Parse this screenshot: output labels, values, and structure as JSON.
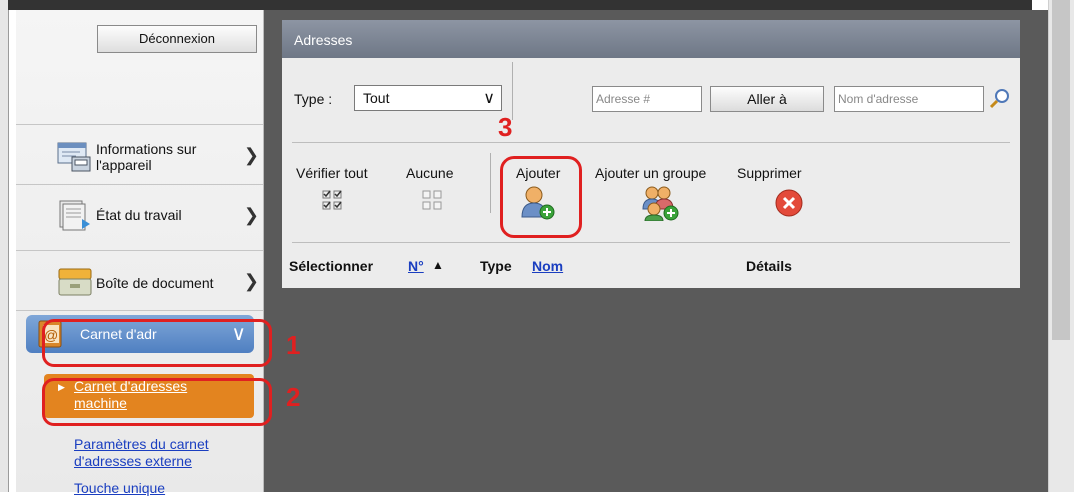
{
  "sidebar": {
    "logout": "Déconnexion",
    "items": [
      {
        "label_line1": "Informations sur",
        "label_line2": "l'appareil",
        "icon": "device-info-icon"
      },
      {
        "label": "État du travail",
        "icon": "job-status-icon"
      },
      {
        "label": "Boîte de document",
        "icon": "document-box-icon"
      }
    ],
    "address_book": {
      "label": "Carnet d'adr",
      "icon": "address-book-icon"
    },
    "submenu": [
      {
        "line1": "Carnet d'adresses",
        "line2": "machine"
      },
      {
        "line1": "Paramètres du carnet",
        "line2": "d'adresses externe"
      },
      {
        "line1": "Touche unique"
      }
    ]
  },
  "panel": {
    "title": "Adresses",
    "type_label": "Type :",
    "type_value": "Tout",
    "address_number_placeholder": "Adresse #",
    "goto_label": "Aller à",
    "address_name_placeholder": "Nom d'adresse",
    "actions": {
      "check_all": "Vérifier tout",
      "none": "Aucune",
      "add": "Ajouter",
      "add_group": "Ajouter un groupe",
      "delete": "Supprimer"
    },
    "columns": {
      "select": "Sélectionner",
      "number": "N°",
      "sort_indicator": "▲",
      "type": "Type",
      "name": "Nom",
      "details": "Détails"
    }
  },
  "callouts": {
    "step1": "1",
    "step2": "2",
    "step3": "3"
  },
  "colors": {
    "highlight": "#e02020",
    "active_nav": "#5b89c9",
    "active_submenu": "#e3841f",
    "panel_header": "#7a8291",
    "link": "#1a3ec0"
  }
}
